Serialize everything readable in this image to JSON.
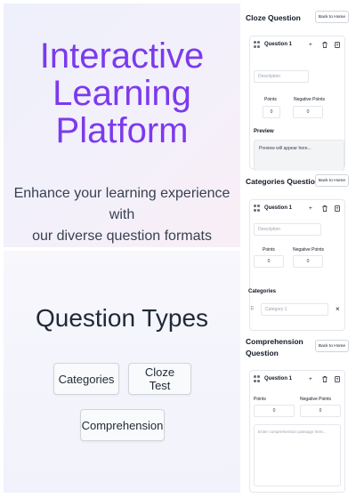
{
  "hero": {
    "title_lines": [
      "Interactive",
      "Learning",
      "Platform"
    ],
    "subtitle_lines": [
      "Enhance your learning experience with",
      "our diverse question formats"
    ]
  },
  "types": {
    "title": "Question Types",
    "buttons": [
      "Categories",
      "Cloze Test",
      "Comprehension"
    ]
  },
  "cloze": {
    "title": "Cloze Question",
    "back": "Back to Home",
    "question_label": "Question 1",
    "description_placeholder": "Description",
    "points_label": "Points",
    "negative_label": "Negative Points",
    "points_value": "0",
    "negative_value": "0",
    "preview_label": "Preview",
    "preview_text": "Preview will appear here..."
  },
  "categories": {
    "title": "Categories Question",
    "back": "Back to Home",
    "question_label": "Question 1",
    "description_placeholder": "Description",
    "points_label": "Points",
    "negative_label": "Negative Points",
    "points_value": "0",
    "negative_value": "0",
    "categories_label": "Categories",
    "category_placeholder": "Category 1",
    "remove_glyph": "×"
  },
  "comprehension": {
    "title_lines": [
      "Comprehension",
      "Question"
    ],
    "back": "Back to Home",
    "question_label": "Question 1",
    "points_label": "Points",
    "negative_label": "Negative Points",
    "points_value": "0",
    "negative_value": "0",
    "passage_placeholder": "Enter comprehension passage here..."
  },
  "icons": {
    "add": "+",
    "delete": "trash-icon",
    "copy": "copy-icon",
    "drag": "drag-handle-icon"
  },
  "colors": {
    "accent": "#7c3aed",
    "hero_bg": "#eef0fb"
  }
}
